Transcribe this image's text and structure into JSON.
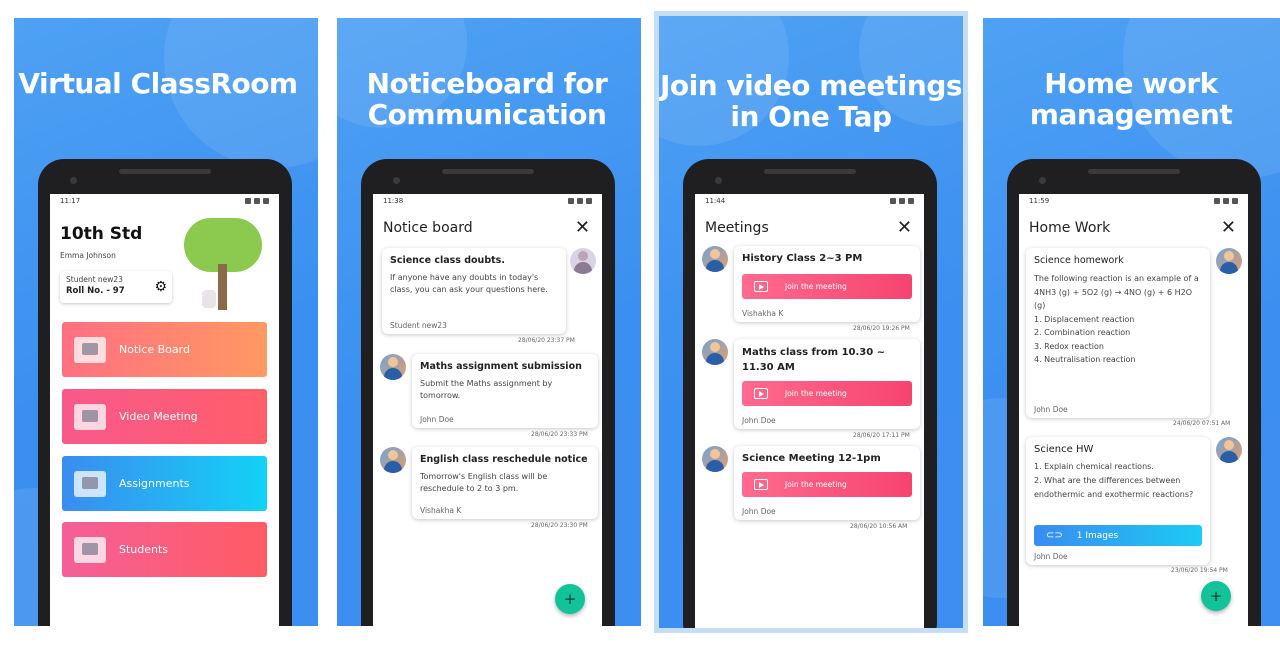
{
  "panels": [
    {
      "headline": "Virtual ClassRoom",
      "status_time": "11:17",
      "class_name": "10th Std",
      "student_name": "Emma Johnson",
      "student_id": "Student new23",
      "roll_no": "Roll No. - 97",
      "menu": [
        "Notice Board",
        "Video Meeting",
        "Assignments",
        "Students"
      ]
    },
    {
      "headline": "Noticeboard for Communication",
      "status_time": "11:38",
      "screen_title": "Notice board",
      "cards": [
        {
          "title": "Science class doubts.",
          "body": "If anyone have any doubts in today's class, you can ask your questions here.",
          "author": "Student new23",
          "time": "28/06/20 23:37 PM"
        },
        {
          "title": "Maths assignment submission",
          "body": "Submit the Maths assignment by tomorrow.",
          "author": "John Doe",
          "time": "28/06/20 23:33 PM"
        },
        {
          "title": "English class reschedule notice",
          "body": "Tomorrow's English class will be reschedule to 2 to 3 pm.",
          "author": "Vishakha K",
          "time": "28/06/20 23:30 PM"
        }
      ]
    },
    {
      "headline": "Join video meetings in One Tap",
      "status_time": "11:44",
      "screen_title": "Meetings",
      "join_label": "Join the meeting",
      "meetings": [
        {
          "title": "History Class 2~3 PM",
          "author": "Vishakha K",
          "time": "28/06/20 19:26 PM"
        },
        {
          "title": "Maths class from 10.30 ~ 11.30 AM",
          "author": "John Doe",
          "time": "28/06/20 17:11 PM"
        },
        {
          "title": "Science Meeting 12-1pm",
          "author": "John Doe",
          "time": "28/06/20 10:56 AM"
        }
      ]
    },
    {
      "headline": "Home work management",
      "status_time": "11:59",
      "screen_title": "Home Work",
      "homework": [
        {
          "title": "Science homework",
          "body": "The following reaction is an example of a\n4NH3 (g) + 5O2 (g) → 4NO (g) + 6 H2O (g)\n1. Displacement reaction\n2. Combination reaction\n3. Redox reaction\n4. Neutralisation reaction",
          "author": "John Doe",
          "time": "24/06/20 07:51 AM"
        },
        {
          "title": "Science HW",
          "body": "1. Explain chemical reactions.\n2. What are the differences between endothermic and exothermic reactions?",
          "attachment": "1 Images",
          "author": "John Doe",
          "time": "23/06/20 19:54 PM"
        }
      ]
    }
  ],
  "colors": {
    "panel_bg": "#3b8ff0",
    "fab": "#12c39a",
    "join_button": "#f5446f",
    "images_button": "#1fb8e8"
  }
}
